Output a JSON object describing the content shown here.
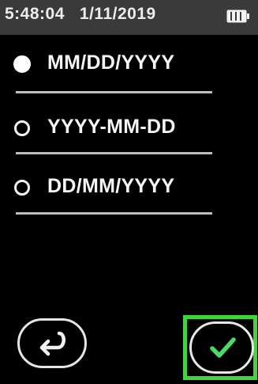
{
  "status_bar": {
    "time": "5:48:04",
    "date": "1/11/2019",
    "battery_icon": "battery-full-icon"
  },
  "options": [
    {
      "label": "MM/DD/YYYY",
      "selected": true
    },
    {
      "label": "YYYY-MM-DD",
      "selected": false
    },
    {
      "label": "DD/MM/YYYY",
      "selected": false
    }
  ],
  "buttons": {
    "back_icon": "return-arrow-icon",
    "confirm_icon": "checkmark-icon"
  },
  "colors": {
    "status_bar_bg": "#3a3a3a",
    "highlight": "#3fd63a",
    "checkmark": "#4cd964",
    "background": "#000000"
  }
}
